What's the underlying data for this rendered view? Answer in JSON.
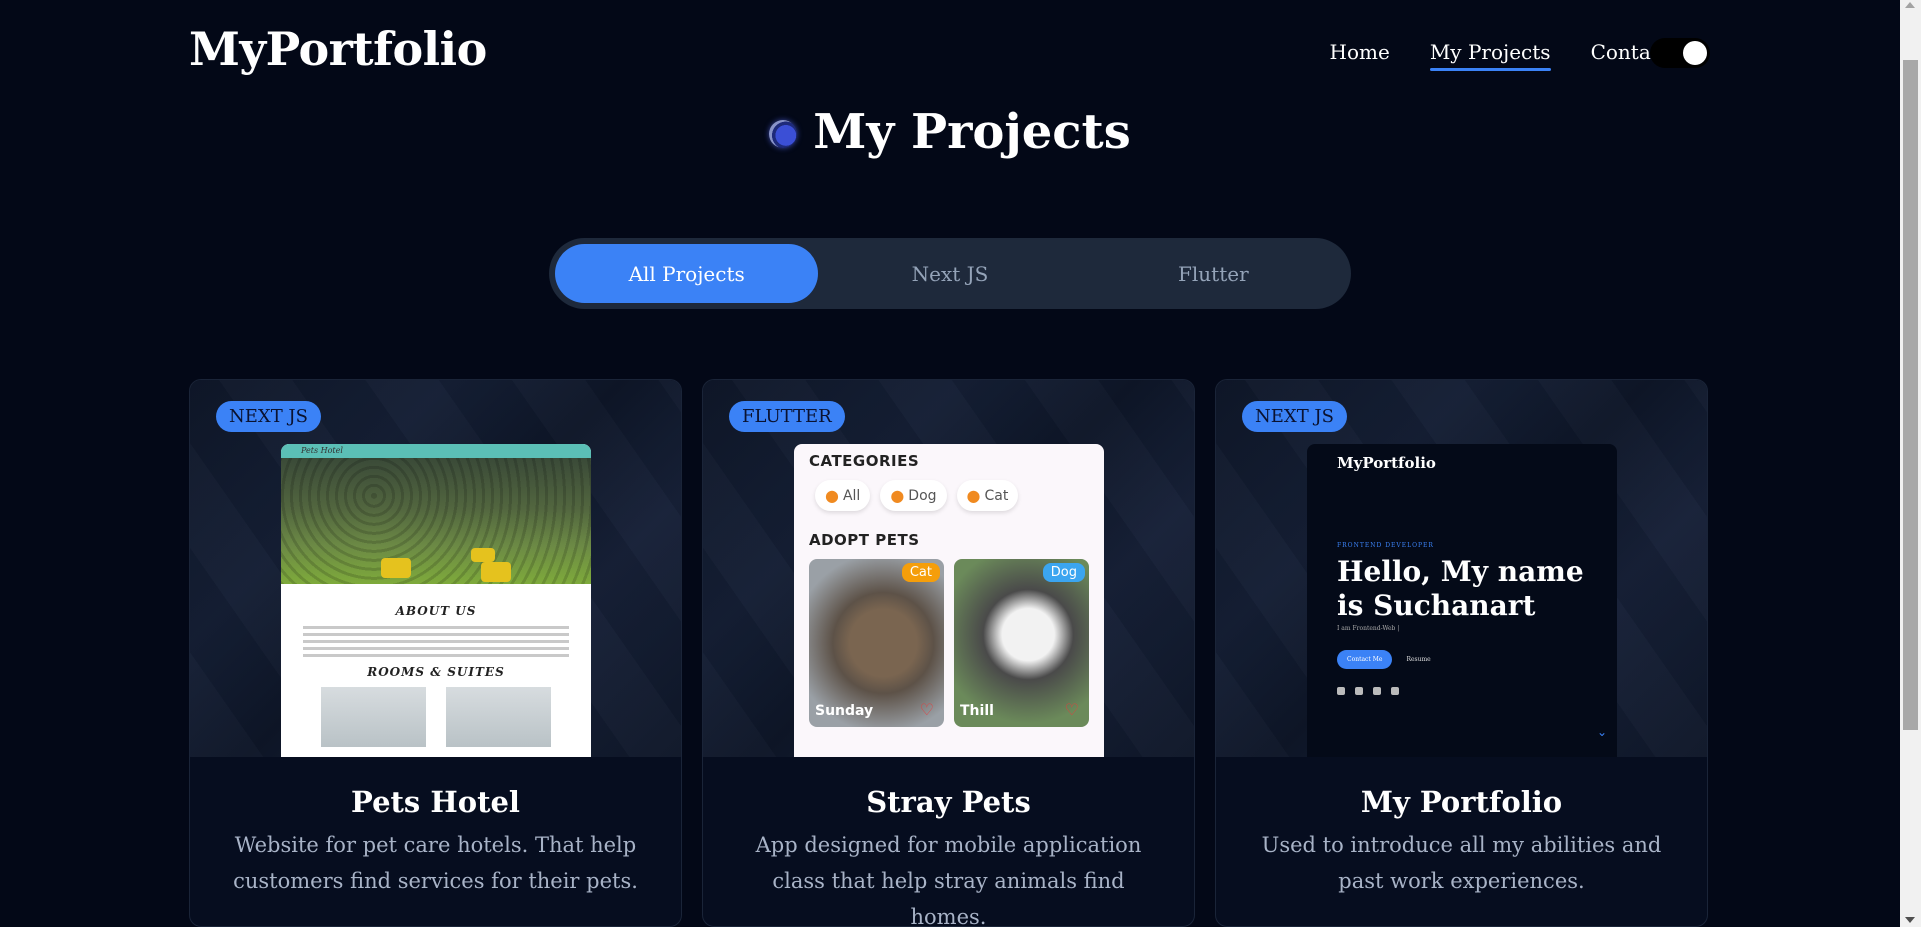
{
  "header": {
    "brand": "MyPortfolio",
    "nav": [
      {
        "label": "Home",
        "active": false
      },
      {
        "label": "My Projects",
        "active": true
      },
      {
        "label": "Contact",
        "active": false
      }
    ],
    "theme_toggle": "dark-mode-toggle"
  },
  "section": {
    "title": "My Projects"
  },
  "filters": {
    "tabs": [
      {
        "label": "All Projects",
        "active": true
      },
      {
        "label": "Next JS",
        "active": false
      },
      {
        "label": "Flutter",
        "active": false
      }
    ]
  },
  "projects": [
    {
      "badge": "NEXT JS",
      "title": "Pets Hotel",
      "description": "Website for pet care hotels. That help customers find services for their pets.",
      "preview": {
        "top_label": "Pets Hotel",
        "heading1": "ABOUT US",
        "heading2": "ROOMS & SUITES"
      }
    },
    {
      "badge": "FLUTTER",
      "title": "Stray Pets",
      "description": "App designed for mobile application class that help stray animals find homes.",
      "preview": {
        "categories_heading": "CATEGORIES",
        "chips": [
          "All",
          "Dog",
          "Cat"
        ],
        "adopt_heading": "ADOPT PETS",
        "pets": [
          {
            "name": "Sunday",
            "tag": "Cat"
          },
          {
            "name": "Thill",
            "tag": "Dog"
          }
        ]
      }
    },
    {
      "badge": "NEXT JS",
      "title": "My Portfolio",
      "description": "Used to introduce all my abilities and past work experiences.",
      "preview": {
        "logo": "MyPortfolio",
        "role": "FRONTEND DEVELOPER",
        "hello": "Hello, My name is Suchanart",
        "sub": "I am Frontend-Web |",
        "contact_button": "Contact Me",
        "resume_button": "Resume"
      }
    }
  ],
  "colors": {
    "background": "#030817",
    "accent": "#3b82f6",
    "card": "#060d1f",
    "tab_bg": "#1e293b",
    "muted_text": "#a8b3c7"
  }
}
